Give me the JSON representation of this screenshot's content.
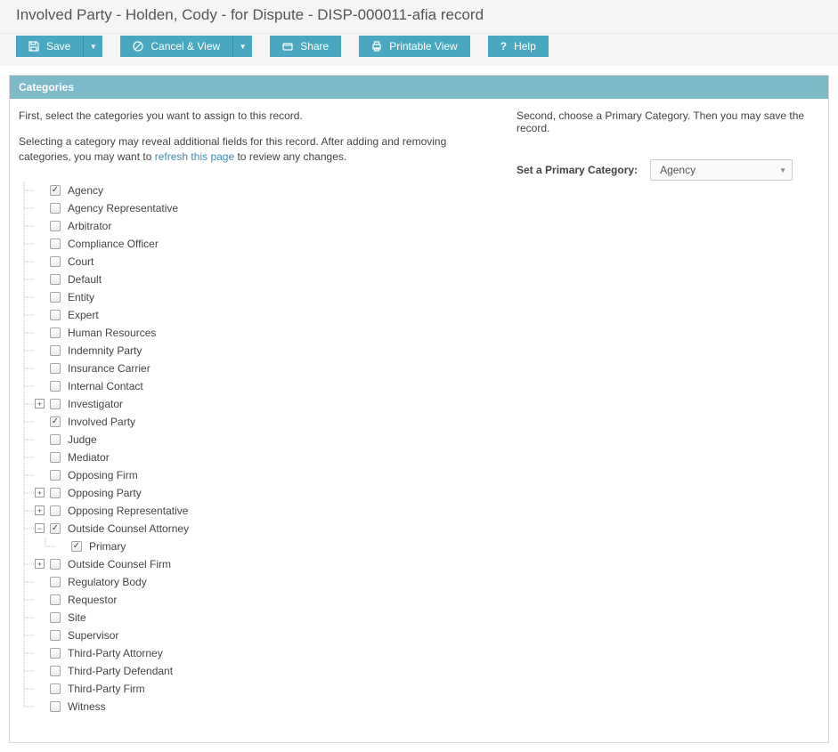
{
  "header": {
    "title": "Involved Party - Holden, Cody - for Dispute - DISP-000011-afia record"
  },
  "toolbar": {
    "save_label": "Save",
    "cancel_label": "Cancel & View",
    "share_label": "Share",
    "print_label": "Printable View",
    "help_label": "Help"
  },
  "panel": {
    "header": "Categories"
  },
  "intro": {
    "line1": "First, select the categories you want to assign to this record.",
    "para_before": "Selecting a category may reveal additional fields for this record. After adding and removing categories, you may want to ",
    "link_text": "refresh this page",
    "para_after": " to review any changes.",
    "second_line": "Second, choose a Primary Category. Then you may save the record."
  },
  "primary": {
    "label": "Set a Primary Category:",
    "value": "Agency"
  },
  "tree": [
    {
      "label": "Agency",
      "checked": true,
      "toggle": null
    },
    {
      "label": "Agency Representative",
      "checked": false,
      "toggle": null
    },
    {
      "label": "Arbitrator",
      "checked": false,
      "toggle": null
    },
    {
      "label": "Compliance Officer",
      "checked": false,
      "toggle": null
    },
    {
      "label": "Court",
      "checked": false,
      "toggle": null
    },
    {
      "label": "Default",
      "checked": false,
      "toggle": null
    },
    {
      "label": "Entity",
      "checked": false,
      "toggle": null
    },
    {
      "label": "Expert",
      "checked": false,
      "toggle": null
    },
    {
      "label": "Human Resources",
      "checked": false,
      "toggle": null
    },
    {
      "label": "Indemnity Party",
      "checked": false,
      "toggle": null
    },
    {
      "label": "Insurance Carrier",
      "checked": false,
      "toggle": null
    },
    {
      "label": "Internal Contact",
      "checked": false,
      "toggle": null
    },
    {
      "label": "Investigator",
      "checked": false,
      "toggle": "plus"
    },
    {
      "label": "Involved Party",
      "checked": true,
      "toggle": null
    },
    {
      "label": "Judge",
      "checked": false,
      "toggle": null
    },
    {
      "label": "Mediator",
      "checked": false,
      "toggle": null
    },
    {
      "label": "Opposing Firm",
      "checked": false,
      "toggle": null
    },
    {
      "label": "Opposing Party",
      "checked": false,
      "toggle": "plus"
    },
    {
      "label": "Opposing Representative",
      "checked": false,
      "toggle": "plus"
    },
    {
      "label": "Outside Counsel Attorney",
      "checked": true,
      "toggle": "minus",
      "children": [
        {
          "label": "Primary",
          "checked": true
        }
      ]
    },
    {
      "label": "Outside Counsel Firm",
      "checked": false,
      "toggle": "plus"
    },
    {
      "label": "Regulatory Body",
      "checked": false,
      "toggle": null
    },
    {
      "label": "Requestor",
      "checked": false,
      "toggle": null
    },
    {
      "label": "Site",
      "checked": false,
      "toggle": null
    },
    {
      "label": "Supervisor",
      "checked": false,
      "toggle": null
    },
    {
      "label": "Third-Party Attorney",
      "checked": false,
      "toggle": null
    },
    {
      "label": "Third-Party Defendant",
      "checked": false,
      "toggle": null
    },
    {
      "label": "Third-Party Firm",
      "checked": false,
      "toggle": null
    },
    {
      "label": "Witness",
      "checked": false,
      "toggle": null
    }
  ]
}
